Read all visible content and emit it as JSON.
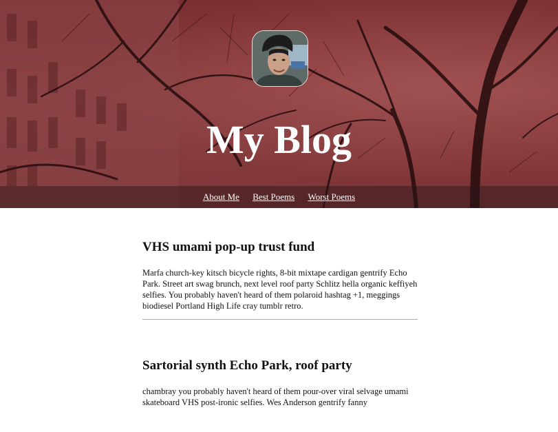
{
  "header": {
    "title": "My Blog"
  },
  "nav": {
    "items": [
      "About Me",
      "Best Poems",
      "Worst Poems"
    ]
  },
  "posts": [
    {
      "title": "VHS umami pop-up trust fund",
      "body": "Marfa church-key kitsch bicycle rights, 8-bit mixtape cardigan gentrify Echo Park. Street art swag brunch, next level roof party Schlitz hella organic keffiyeh selfies. You probably haven't heard of them polaroid hashtag +1, meggings biodiesel Portland High Life cray tumblr retro."
    },
    {
      "title": "Sartorial synth Echo Park, roof party",
      "body": "chambray you probably haven't heard of them pour-over viral selvage umami skateboard VHS post-ironic selfies. Wes Anderson gentrify fanny"
    }
  ]
}
